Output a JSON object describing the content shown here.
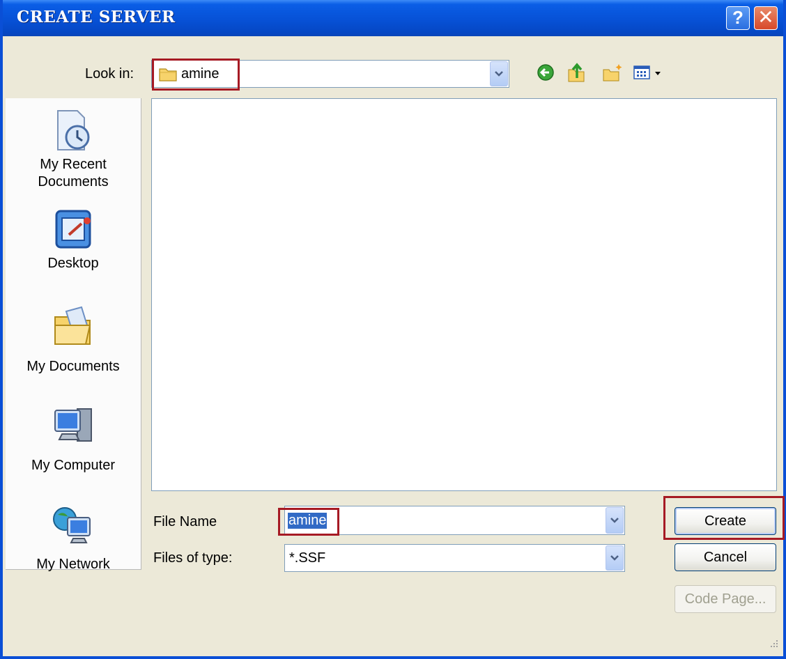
{
  "dialog": {
    "title": "CREATE SERVER"
  },
  "look_in": {
    "label": "Look in:",
    "value": "amine"
  },
  "places": [
    {
      "label": "My Recent Documents",
      "line1": "My Recent",
      "line2": "Documents",
      "icon": "recent-documents-icon"
    },
    {
      "label": "Desktop",
      "line1": "Desktop",
      "icon": "desktop-icon"
    },
    {
      "label": "My Documents",
      "line1": "My Documents",
      "icon": "my-documents-icon"
    },
    {
      "label": "My Computer",
      "line1": "My Computer",
      "icon": "my-computer-icon"
    },
    {
      "label": "My Network",
      "line1": "My Network",
      "icon": "my-network-icon"
    }
  ],
  "file_name": {
    "label": "File Name",
    "value": "amine"
  },
  "file_type": {
    "label": "Files of type:",
    "value": "*.SSF"
  },
  "buttons": {
    "create": "Create",
    "cancel": "Cancel",
    "code_page": "Code Page..."
  },
  "colors": {
    "title_bar": "#0751d6",
    "dialog_bg": "#ece9d8",
    "highlight_box": "#a61a24",
    "selection": "#316ac5"
  }
}
